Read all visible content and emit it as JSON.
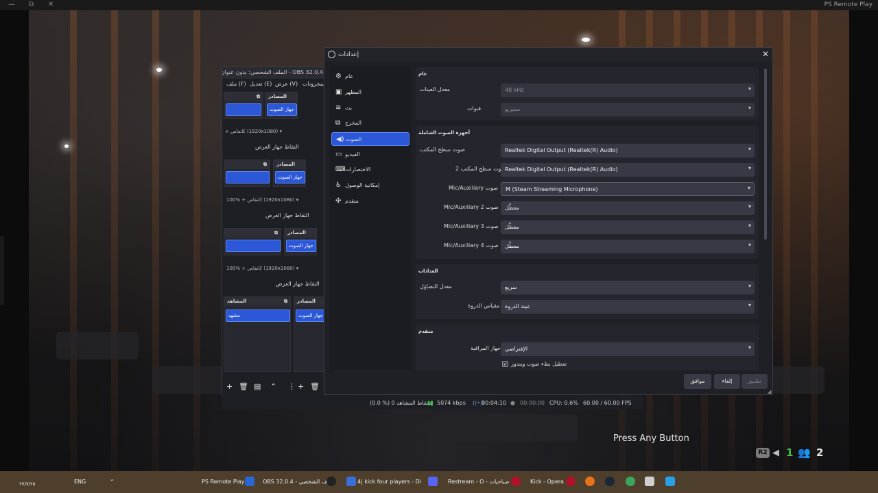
{
  "remote_play": {
    "window_title": "PS Remote Play",
    "controls": [
      "—",
      "⧉",
      "✕"
    ],
    "prompt": "Press Any Button",
    "hud": {
      "r2": "R2",
      "count_1": "1",
      "count_2": "2"
    }
  },
  "obs": {
    "title": "OBS 32.0.4 - الملف الشخصي: بدون عنوان - المشاهد: بدون عنوان",
    "menu": [
      "ملف (F)",
      "تعديل (E)",
      "عرض (V)",
      "المخزونات"
    ],
    "sources_header": "المصادر",
    "scenes_header": "المشاهد",
    "source_item": "جهاز الصوت",
    "scene_item": "مشهد",
    "capture_label": "التقاط جهاز العرض",
    "zoom_label": "كانفاس (1920x1080)",
    "zoom_pct": "100%",
    "status": {
      "dropped": "(0.0 %) 0 إسقاط المشاهد",
      "bitrate": "5074 kbps",
      "time1": "00:04:10",
      "time2": "00:00:00",
      "cpu": "CPU: 0.6%",
      "fps": "60.00 / 60.00 FPS"
    }
  },
  "settings": {
    "title": "إعدادات",
    "nav": [
      {
        "label": "عام",
        "icon": "⚙"
      },
      {
        "label": "المظهر",
        "icon": "▣"
      },
      {
        "label": "بث",
        "icon": "((•))"
      },
      {
        "label": "المخرج",
        "icon": "⧉"
      },
      {
        "label": "الصوت",
        "icon": "🔊"
      },
      {
        "label": "الفيديو",
        "icon": "▭"
      },
      {
        "label": "الاختصارات",
        "icon": "⌨"
      },
      {
        "label": "إمكانية الوصول",
        "icon": "♿"
      },
      {
        "label": "متقدم",
        "icon": "✣"
      }
    ],
    "general": {
      "header": "عام",
      "sample_rate_label": "معدل العينات",
      "sample_rate_value": "48 kHz",
      "channels_label": "قنوات",
      "channels_value": "ستيريو"
    },
    "global_audio": {
      "header": "أجهزة الصوت الشاملة",
      "rows": [
        {
          "label": "صوت سطح المكتب",
          "value": "Realtek Digital Output (Realtek(R) Audio)"
        },
        {
          "label": "صوت سطح المكتب 2",
          "value": "Realtek Digital Output (Realtek(R) Audio)"
        },
        {
          "label": "Mic/Auxiliary صوت",
          "value": "M (Steam Streaming Microphone)"
        },
        {
          "label": "Mic/Auxiliary 2 صوت",
          "value": "معطّل"
        },
        {
          "label": "Mic/Auxiliary 3 صوت",
          "value": "معطّل"
        },
        {
          "label": "Mic/Auxiliary 4 صوت",
          "value": "معطّل"
        }
      ]
    },
    "meters": {
      "header": "العدادات",
      "decay_label": "معدل التضاؤل",
      "decay_value": "سريع",
      "peak_label": "نوع مقياس الذروة",
      "peak_value": "عينة الذروة"
    },
    "advanced": {
      "header": "متقدم",
      "monitor_label": "جهاز المراقبة",
      "monitor_value": "الإفتراضي",
      "ducking_label": "تعطيل بطء صوت ويندوز"
    },
    "buttons": {
      "ok": "موافق",
      "cancel": "إلغاء",
      "apply": "تطبيق"
    }
  },
  "taskbar": {
    "date": "٢٧/٧/٢٥",
    "lang": "ENG",
    "items": [
      "PS Remote Play",
      "OBS 32.0.4 - الملف الشخصي",
      "4| kick four players - Di",
      "Restream - O - صباحيات",
      "Kick - Opera"
    ]
  }
}
